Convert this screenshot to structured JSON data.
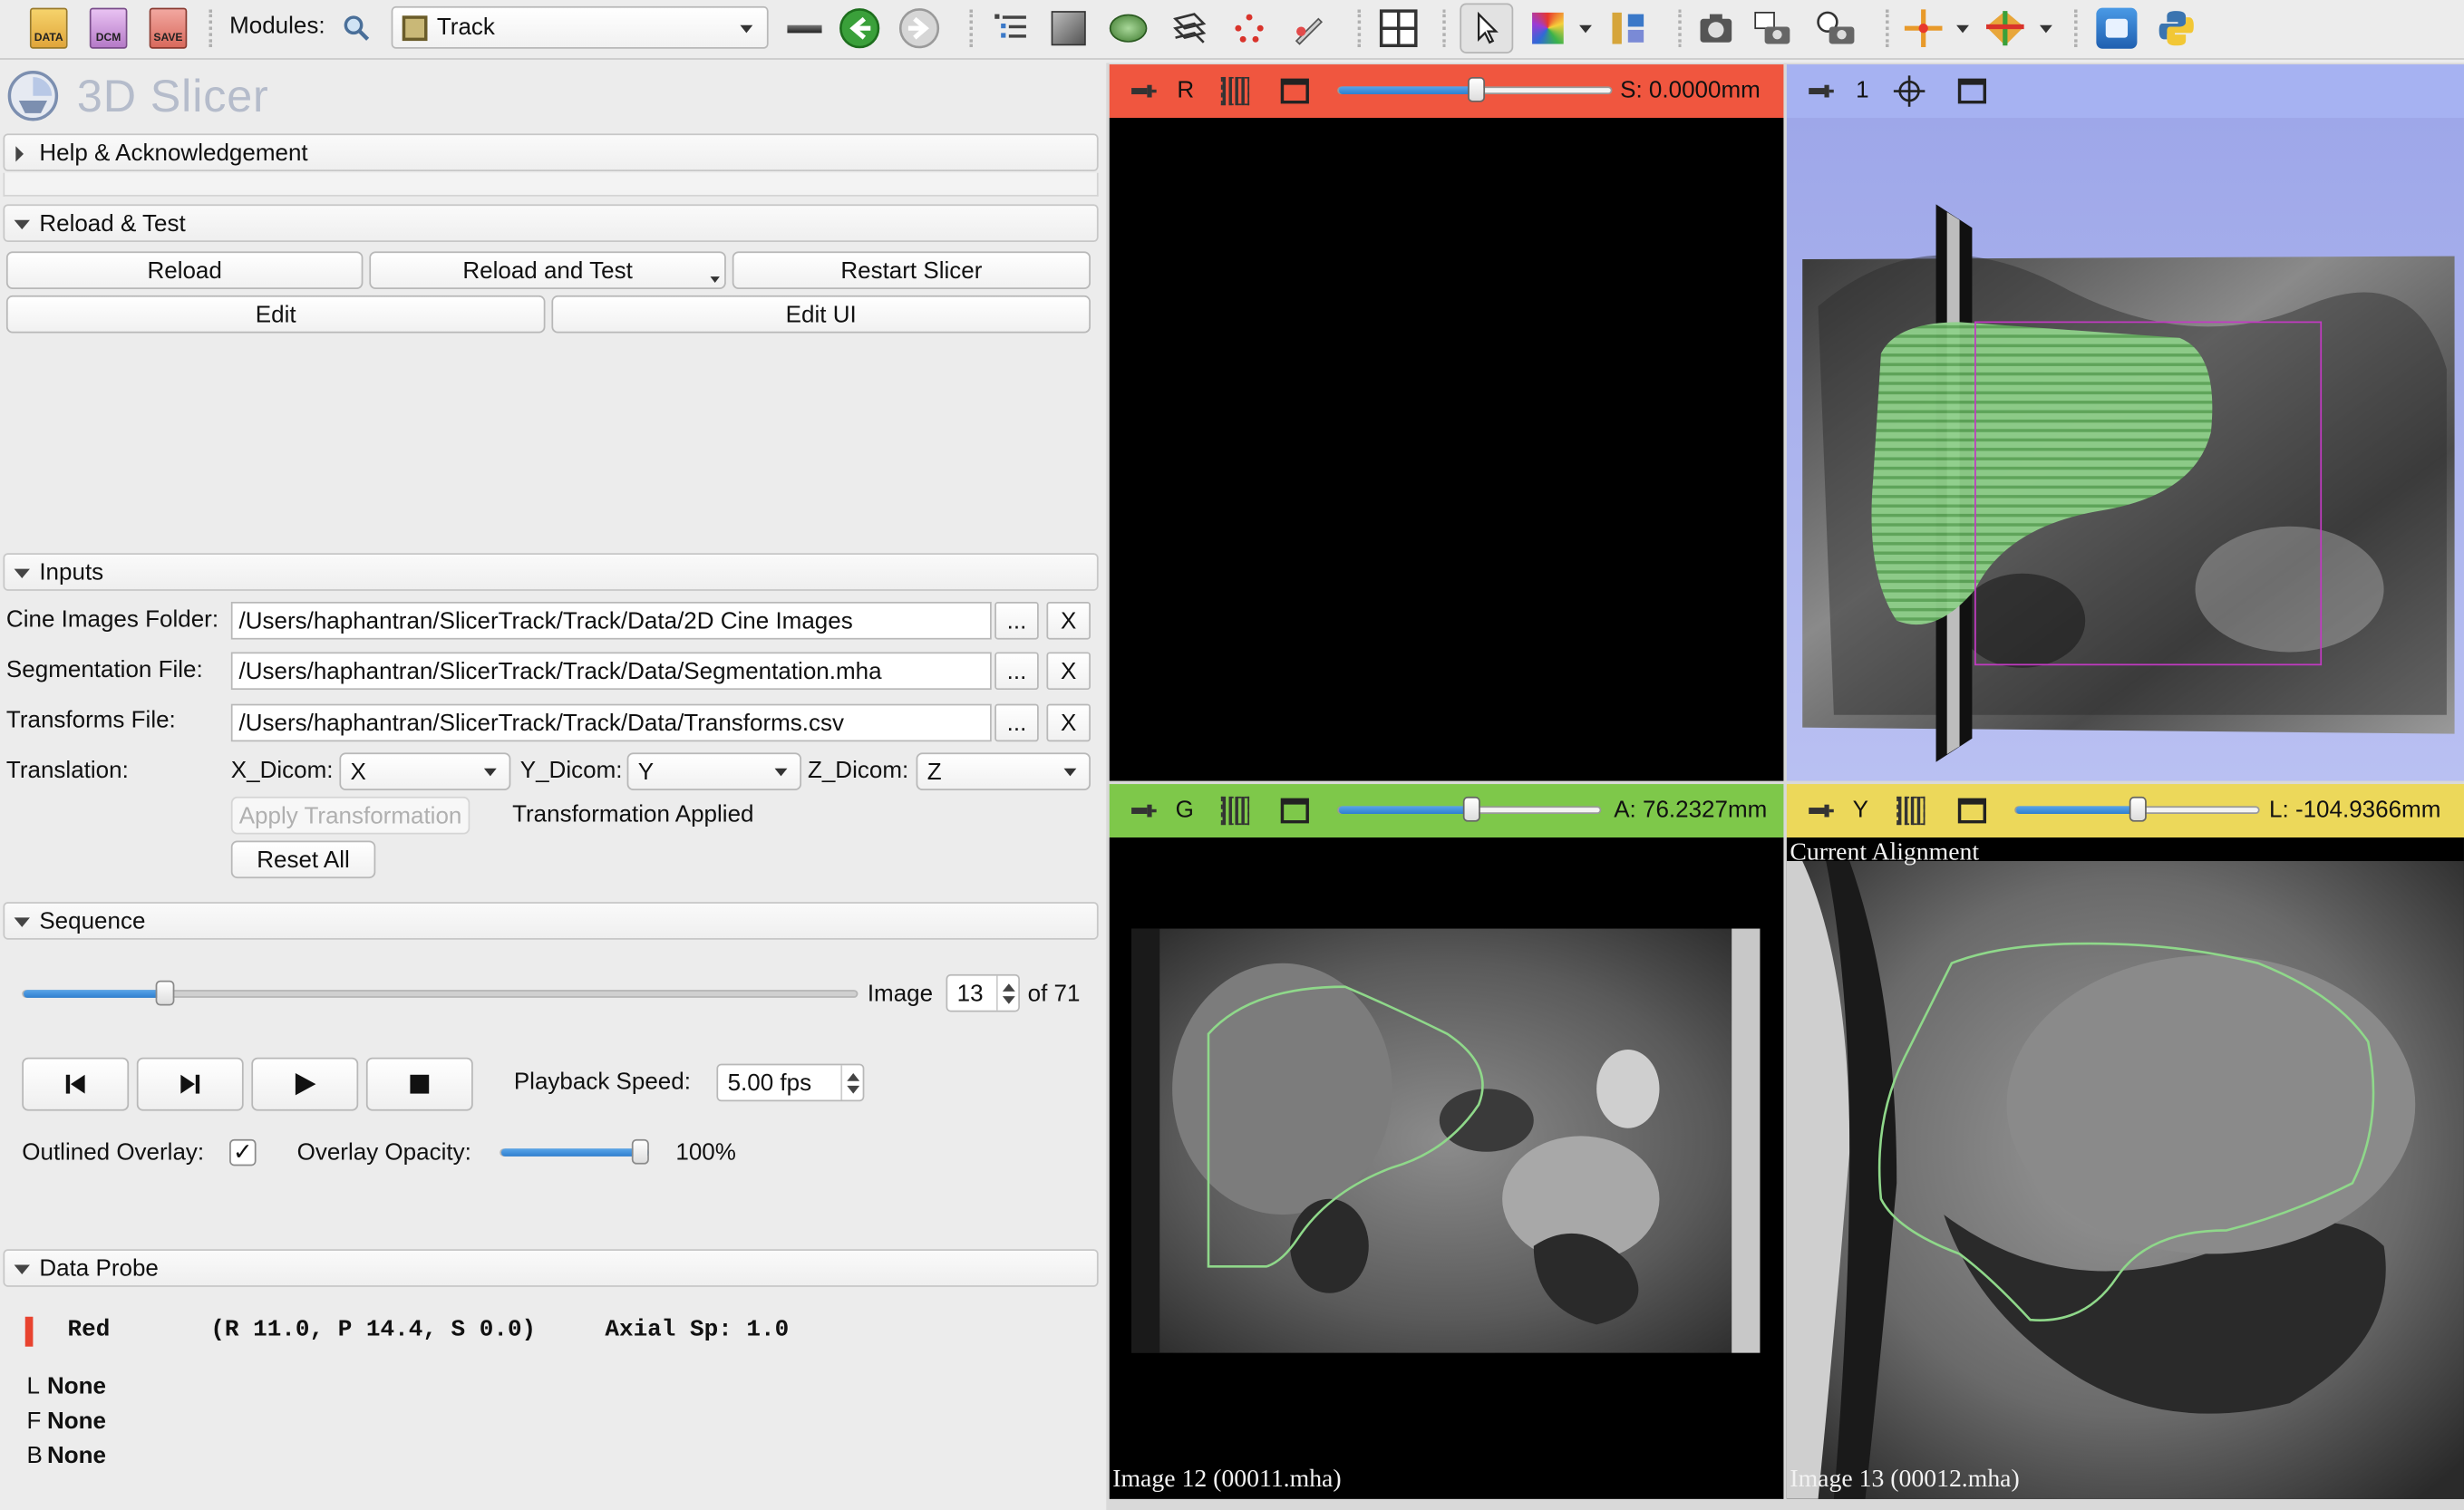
{
  "toolbar": {
    "load_data_label": "DATA",
    "dicom_label": "DCM",
    "save_label": "SAVE",
    "modules_label": "Modules:",
    "module_selected": "Track"
  },
  "header": {
    "app_title": "3D Slicer"
  },
  "sections": {
    "help": "Help & Acknowledgement",
    "reload_test": "Reload & Test",
    "inputs": "Inputs",
    "sequence": "Sequence",
    "data_probe": "Data Probe"
  },
  "reload": {
    "reload": "Reload",
    "reload_and_test": "Reload and Test",
    "restart": "Restart Slicer",
    "edit": "Edit",
    "edit_ui": "Edit UI"
  },
  "inputs": {
    "cine_label": "Cine Images Folder:",
    "cine_value": "/Users/haphantran/SlicerTrack/Track/Data/2D Cine Images",
    "seg_label": "Segmentation File:",
    "seg_value": "/Users/haphantran/SlicerTrack/Track/Data/Segmentation.mha",
    "transforms_label": "Transforms File:",
    "transforms_value": "/Users/haphantran/SlicerTrack/Track/Data/Transforms.csv",
    "browse": "...",
    "clear": "X",
    "translation_label": "Translation:",
    "x_label": "X_Dicom:",
    "x_value": "X",
    "y_label": "Y_Dicom:",
    "y_value": "Y",
    "z_label": "Z_Dicom:",
    "z_value": "Z",
    "apply": "Apply Transformation",
    "applied_status": "Transformation Applied",
    "reset": "Reset All"
  },
  "sequence": {
    "image_label": "Image",
    "current_image": "13",
    "of_total": "of 71",
    "slider_fraction": 0.17,
    "playback_label": "Playback Speed:",
    "playback_value": "5.00 fps",
    "outlined_label": "Outlined Overlay:",
    "outlined_checked": "✓",
    "opacity_label": "Overlay Opacity:",
    "opacity_value": "100%",
    "opacity_fraction": 1.0
  },
  "probe": {
    "layer": "Red",
    "coords": "(R 11.0, P 14.4, S 0.0)",
    "spacing": "Axial Sp: 1.0",
    "l_key": "L",
    "l_val": "None",
    "f_key": "F",
    "f_val": "None",
    "b_key": "B",
    "b_val": "None"
  },
  "views": {
    "red": {
      "letter": "R",
      "offset": "S: 0.0000mm",
      "color": "#f0563f",
      "slider_fraction": 0.5
    },
    "threeD": {
      "letter": "1",
      "color": "#a6b2f2"
    },
    "green": {
      "letter": "G",
      "offset": "A: 76.2327mm",
      "color": "#7ec84a",
      "slider_fraction": 0.5
    },
    "yellow": {
      "letter": "Y",
      "offset": "L: -104.9366mm",
      "color": "#ecd85a",
      "slider_fraction": 0.5
    },
    "yellow_top_overlay": "Current Alignment",
    "green_bottom_overlay": "Image 12 (00011.mha)",
    "yellow_bottom_overlay": "Image 13 (00012.mha)"
  }
}
